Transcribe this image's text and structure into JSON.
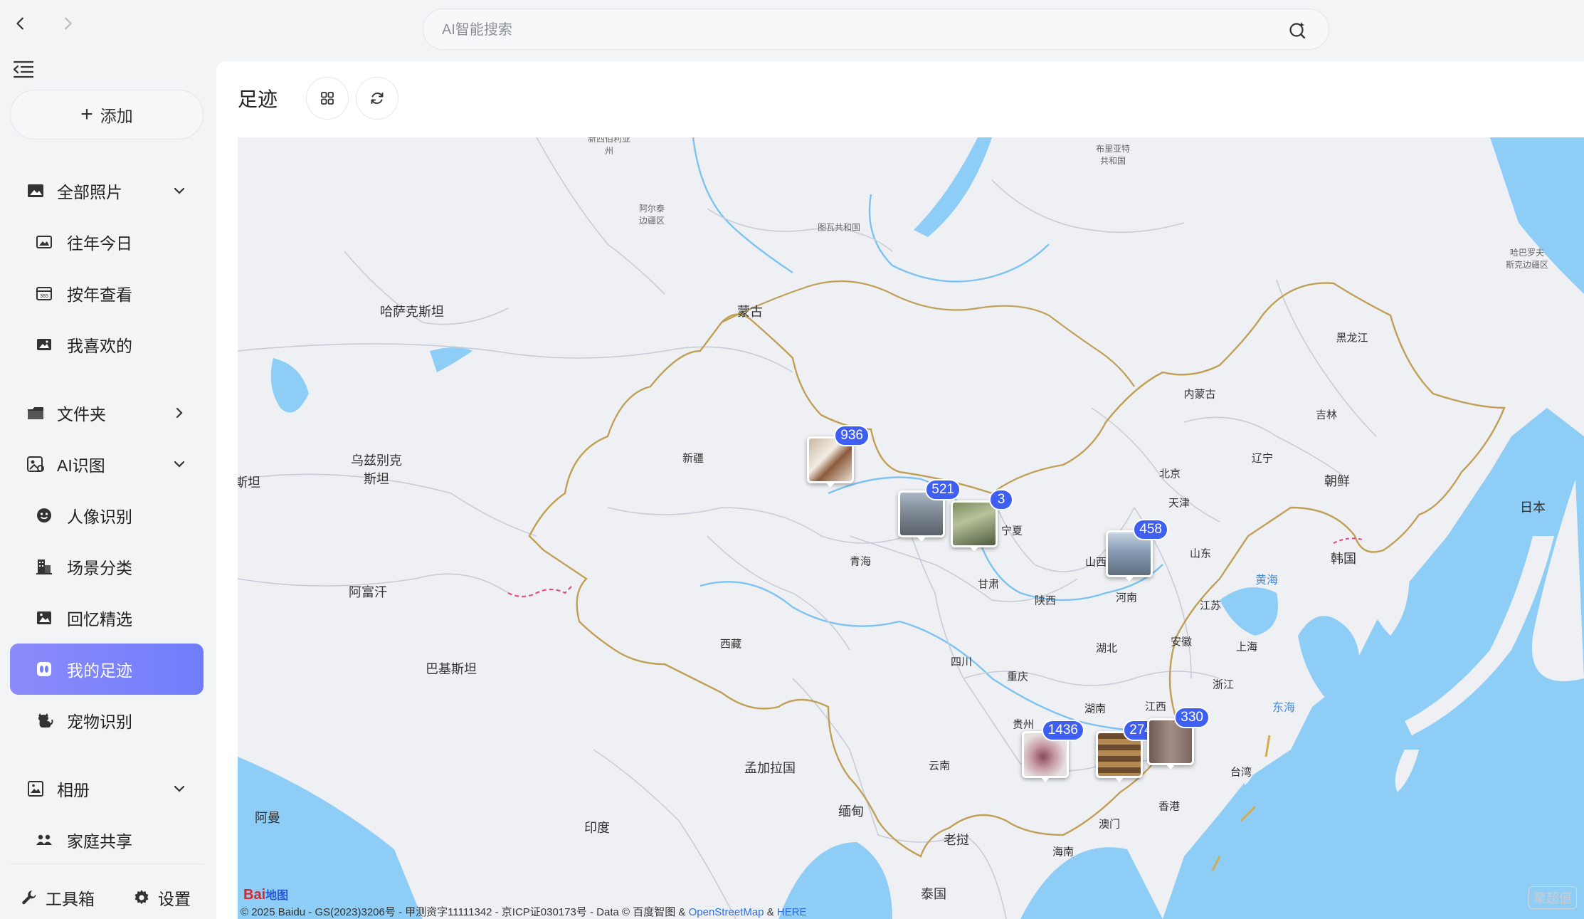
{
  "nav": {
    "back": "back",
    "forward": "forward"
  },
  "search": {
    "placeholder": "AI智能搜索"
  },
  "sidebar": {
    "add_label": "添加",
    "all_photos": "全部照片",
    "memories_today": "往年今日",
    "by_year": "按年查看",
    "favorites": "我喜欢的",
    "folders": "文件夹",
    "ai_recognition": "AI识图",
    "portrait": "人像识别",
    "scene": "场景分类",
    "memories": "回忆精选",
    "footprints": "我的足迹",
    "pets": "宠物识别",
    "albums": "相册",
    "family": "家庭共享",
    "toolbox": "工具箱",
    "settings": "设置"
  },
  "main": {
    "title": "足迹"
  },
  "map": {
    "places": {
      "mongolia": "蒙古",
      "kazakhstan": "哈萨克斯坦",
      "uzbekistan": "乌兹别克\n斯坦",
      "afghanistan": "阿富汗",
      "pakistan": "巴基斯坦",
      "xinjiang": "新疆",
      "xizang": "西藏",
      "qinghai": "青海",
      "gansu": "甘肃",
      "ningxia": "宁夏",
      "neimenggu": "内蒙古",
      "heilongjiang": "黑龙江",
      "jilin": "吉林",
      "liaoning": "辽宁",
      "beijing": "北京",
      "tianjin": "天津",
      "shanxi": "山西",
      "shandong": "山东",
      "henan": "河南",
      "shaanxi": "陕西",
      "jiangsu": "江苏",
      "anhui": "安徽",
      "shanghai": "上海",
      "hubei": "湖北",
      "sichuan": "四川",
      "chongqing": "重庆",
      "zhejiang": "浙江",
      "hunan": "湖南",
      "jiangxi": "江西",
      "guizhou": "贵州",
      "yunnan": "云南",
      "taiwan": "台湾",
      "hongkong": "香港",
      "macau": "澳门",
      "hainan": "海南",
      "northkorea": "朝鲜",
      "southkorea": "韩国",
      "japan": "日本",
      "yellowsea": "黄海",
      "eastsea": "东海",
      "bangladesh": "孟加拉国",
      "india": "印度",
      "myanmar": "缅甸",
      "laos": "老挝",
      "thailand": "泰国",
      "oman": "阿曼",
      "stan_left": "斯坦",
      "tuva": "图瓦共和国",
      "buryatia": "布里亚特\n共和国",
      "altai": "阿尔泰\n边疆区",
      "khabarovsk": "哈巴罗夫\n斯克边疆区",
      "novosibirsk": "新西伯利亚\n州"
    },
    "markers": [
      {
        "count": "936"
      },
      {
        "count": "521"
      },
      {
        "count": "3"
      },
      {
        "count": "458"
      },
      {
        "count": "1436"
      },
      {
        "count": "274"
      },
      {
        "count": "330"
      }
    ],
    "logo": "Bai",
    "logo_sub": "地图",
    "copyright": "© 2025 Baidu - GS(2023)3206号 - 甲测资字11111342 - 京ICP证030173号 - Data © 百度智图 &",
    "osm": "OpenStreetMap",
    "amp": "&",
    "here": "HERE",
    "watermark": "聚超值"
  }
}
